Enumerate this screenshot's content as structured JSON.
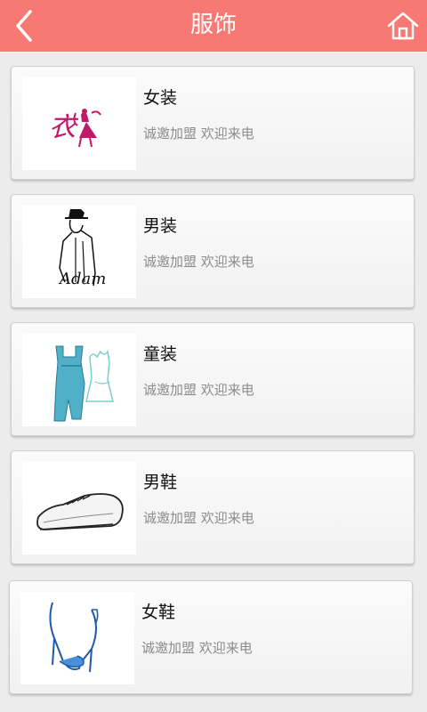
{
  "header": {
    "title": "服饰",
    "back_icon": "chevron-left-icon",
    "home_icon": "home-icon",
    "background": "#f87973"
  },
  "items": [
    {
      "name": "女装",
      "desc": "诚邀加盟 欢迎来电",
      "image": "womens-clothing-logo"
    },
    {
      "name": "男装",
      "desc": "诚邀加盟 欢迎来电",
      "image": "mens-clothing-sketch"
    },
    {
      "name": "童装",
      "desc": "诚邀加盟 欢迎来电",
      "image": "kids-clothing-sketch"
    },
    {
      "name": "男鞋",
      "desc": "诚邀加盟 欢迎来电",
      "image": "mens-shoe-sketch"
    },
    {
      "name": "女鞋",
      "desc": "诚邀加盟 欢迎来电",
      "image": "womens-shoe-sketch"
    }
  ]
}
